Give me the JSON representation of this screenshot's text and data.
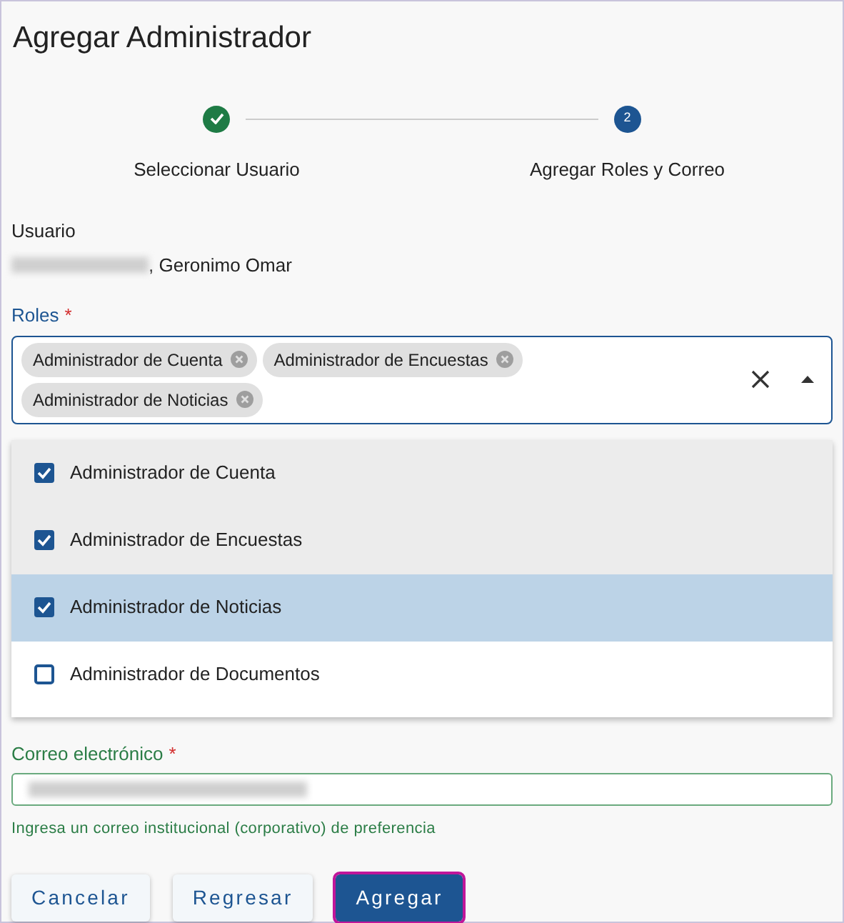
{
  "title": "Agregar Administrador",
  "steps": [
    {
      "label": "Seleccionar Usuario",
      "completed": true
    },
    {
      "label": "Agregar Roles y Correo",
      "number": "2",
      "completed": false
    }
  ],
  "user": {
    "label": "Usuario",
    "name_redacted": true,
    "name": ", Geronimo Omar"
  },
  "roles": {
    "label": "Roles",
    "required_mark": "*",
    "open": true,
    "chips": [
      "Administrador de Cuenta",
      "Administrador de Encuestas",
      "Administrador de Noticias"
    ],
    "options": [
      {
        "label": "Administrador de Cuenta",
        "checked": true,
        "focused": false
      },
      {
        "label": "Administrador de Encuestas",
        "checked": true,
        "focused": false
      },
      {
        "label": "Administrador de Noticias",
        "checked": true,
        "focused": true
      },
      {
        "label": "Administrador de Documentos",
        "checked": false,
        "focused": false
      }
    ]
  },
  "email": {
    "label": "Correo electrónico",
    "required_mark": "*",
    "value_redacted": true,
    "hint": "Ingresa un correo institucional (corporativo) de preferencia"
  },
  "buttons": [
    {
      "label": "Cancelar",
      "kind": "secondary",
      "focused": false
    },
    {
      "label": "Regresar",
      "kind": "secondary",
      "focused": false
    },
    {
      "label": "Agregar",
      "kind": "primary",
      "focused": true
    }
  ]
}
